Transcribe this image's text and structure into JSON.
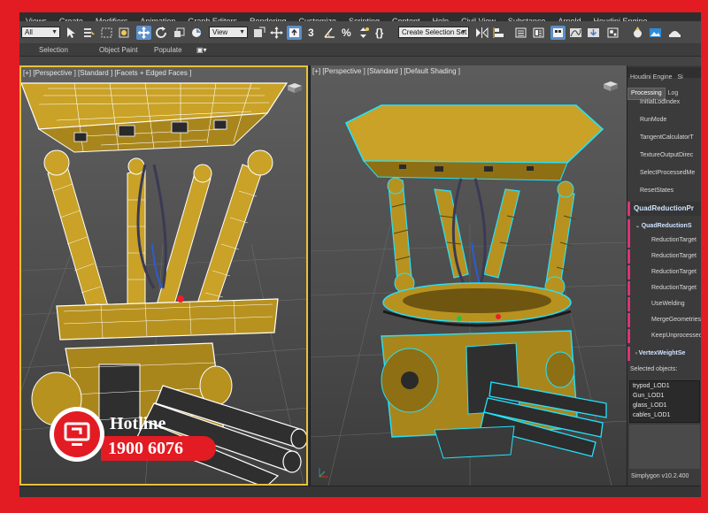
{
  "menubar": {
    "items": [
      "Views",
      "Create",
      "Modifiers",
      "Animation",
      "Graph Editors",
      "Rendering",
      "Customize",
      "Scripting",
      "Content",
      "Help",
      "Civil View",
      "Substance",
      "Arnold",
      "Houdini Engine"
    ]
  },
  "toolbar": {
    "filter_select": "All",
    "refcoord_select": "View",
    "selection_set_select": "Create Selection Set",
    "snap_label": "3",
    "percent_label": "%",
    "braces_label": "{}"
  },
  "ribbon": {
    "tabs": [
      "Selection",
      "Object Paint",
      "Populate"
    ]
  },
  "viewports": {
    "left": {
      "label": "[+] [Perspective ] [Standard ] [Facets + Edged Faces ]"
    },
    "right": {
      "label": "[+] [Perspective ] [Standard ] [Default Shading ]"
    }
  },
  "panel": {
    "tabs": [
      "Houdini Engine",
      "Si"
    ],
    "subtabs": [
      "Processing",
      "Log"
    ],
    "rows": [
      "InitialLodIndex",
      "RunMode",
      "TangentCalculatorT",
      "TextureOutputDirec",
      "SelectProcessedMe",
      "ResetStates"
    ],
    "section_title": "QuadReductionPr",
    "subsection_title": "QuadReductionS",
    "settings": [
      "ReductionTarget",
      "ReductionTarget",
      "ReductionTarget",
      "ReductionTarget",
      "UseWelding",
      "MergeGeometries",
      "KeepUnprocessed"
    ],
    "vertex_weight": "VertexWeightSe",
    "selected_label": "Selected objects:",
    "selected_objects": [
      "trypod_LOD1",
      "Gun_LOD1",
      "glass_LOD1",
      "cables_LOD1"
    ],
    "version": "Simplygon v10.2.400"
  },
  "hotline": {
    "label": "Hotline",
    "number": "1900 6076"
  },
  "colors": {
    "frame": "#e31b23",
    "model_yellow": "#c9a227",
    "selection_outline": "#22e3ff",
    "accent_blue": "#5b8fc7",
    "section_marker": "#e0317a"
  }
}
